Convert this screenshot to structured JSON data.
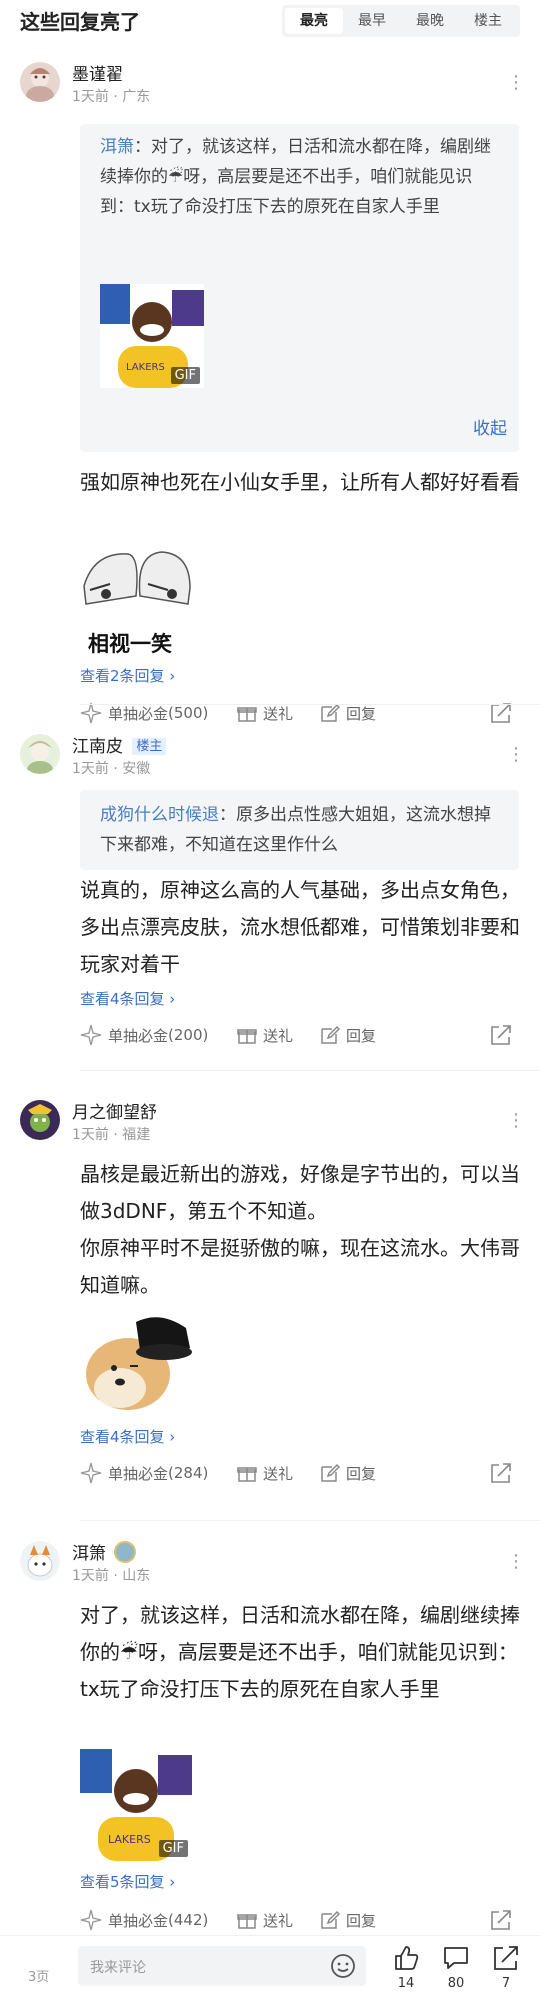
{
  "header": {
    "title": "这些回复亮了",
    "tabs": [
      "最亮",
      "最早",
      "最晚",
      "楼主"
    ]
  },
  "actions": {
    "gold_label": "单抽必金",
    "gift_label": "送礼",
    "reply_label": "回复"
  },
  "comments": [
    {
      "username": "墨谨翟",
      "time": "1天前",
      "location": "广东",
      "quote": {
        "name": "洱箫",
        "sep": "：",
        "text_a": "对了，就该这样，日活和流水都在降，编剧继续捧你的",
        "text_b": "呀，高层要是还不出手，咱们就能见识到：tx玩了命没打压下去的原死在自家人手里",
        "collapse": "收起"
      },
      "text": "强如原神也死在小仙女手里，让所有人都好好看看",
      "sticker_caption": "相视一笑",
      "view_replies": "查看2条回复 ›",
      "gold": "(500)"
    },
    {
      "username": "江南皮",
      "badge": "楼主",
      "time": "1天前",
      "location": "安徽",
      "quote": {
        "name": "成狗什么时候退",
        "sep": "：",
        "text": "原多出点性感大姐姐，这流水想掉下来都难，不知道在这里作什么"
      },
      "text": "说真的，原神这么高的人气基础，多出点女角色，多出点漂亮皮肤，流水想低都难，可惜策划非要和玩家对着干",
      "view_replies": "查看4条回复 ›",
      "gold": "(200)"
    },
    {
      "username": "月之御望舒",
      "time": "1天前",
      "location": "福建",
      "text_1": "晶核是最近新出的游戏，好像是字节出的，可以当做3dDNF，第五个不知道。",
      "text_2": "你原神平时不是挺骄傲的嘛，现在这流水。大伟哥知道嘛。",
      "view_replies": "查看4条回复 ›",
      "gold": "(284)"
    },
    {
      "username": "洱箫",
      "time": "1天前",
      "location": "山东",
      "text_a": "对了，就该这样，日活和流水都在降，编剧继续捧你的",
      "text_b": "呀，高层要是还不出手，咱们就能见识到：tx玩了命没打压下去的原死在自家人手里",
      "view_replies": "查看5条回复 ›",
      "gold": "(442)"
    }
  ],
  "gif_badge": "GIF",
  "bottom": {
    "page": "3页",
    "placeholder": "我来评论",
    "likes": "14",
    "comments": "80",
    "shares": "7"
  },
  "colors": {
    "link": "#3b6fc4",
    "quote_name": "#4a7ec0",
    "badge_bg": "#e3f0ff",
    "badge_text": "#3b6fc4"
  }
}
